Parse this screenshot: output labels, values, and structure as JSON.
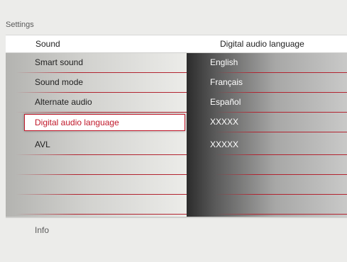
{
  "page": {
    "title": "Settings"
  },
  "header": {
    "left": "Sound",
    "right": "Digital audio language"
  },
  "menu": [
    {
      "label": "Smart sound"
    },
    {
      "label": "Sound mode"
    },
    {
      "label": "Alternate audio"
    },
    {
      "label": "Digital audio language",
      "selected": true
    },
    {
      "label": "AVL"
    },
    {
      "label": ""
    },
    {
      "label": ""
    },
    {
      "label": ""
    }
  ],
  "options": [
    {
      "label": "English"
    },
    {
      "label": "Français"
    },
    {
      "label": "Español"
    },
    {
      "label": "XXXXX"
    },
    {
      "label": "XXXXX"
    },
    {
      "label": ""
    },
    {
      "label": ""
    },
    {
      "label": ""
    }
  ],
  "footer": {
    "info": "Info"
  },
  "colors": {
    "accent": "#c0182a",
    "separator": "#b22430"
  }
}
